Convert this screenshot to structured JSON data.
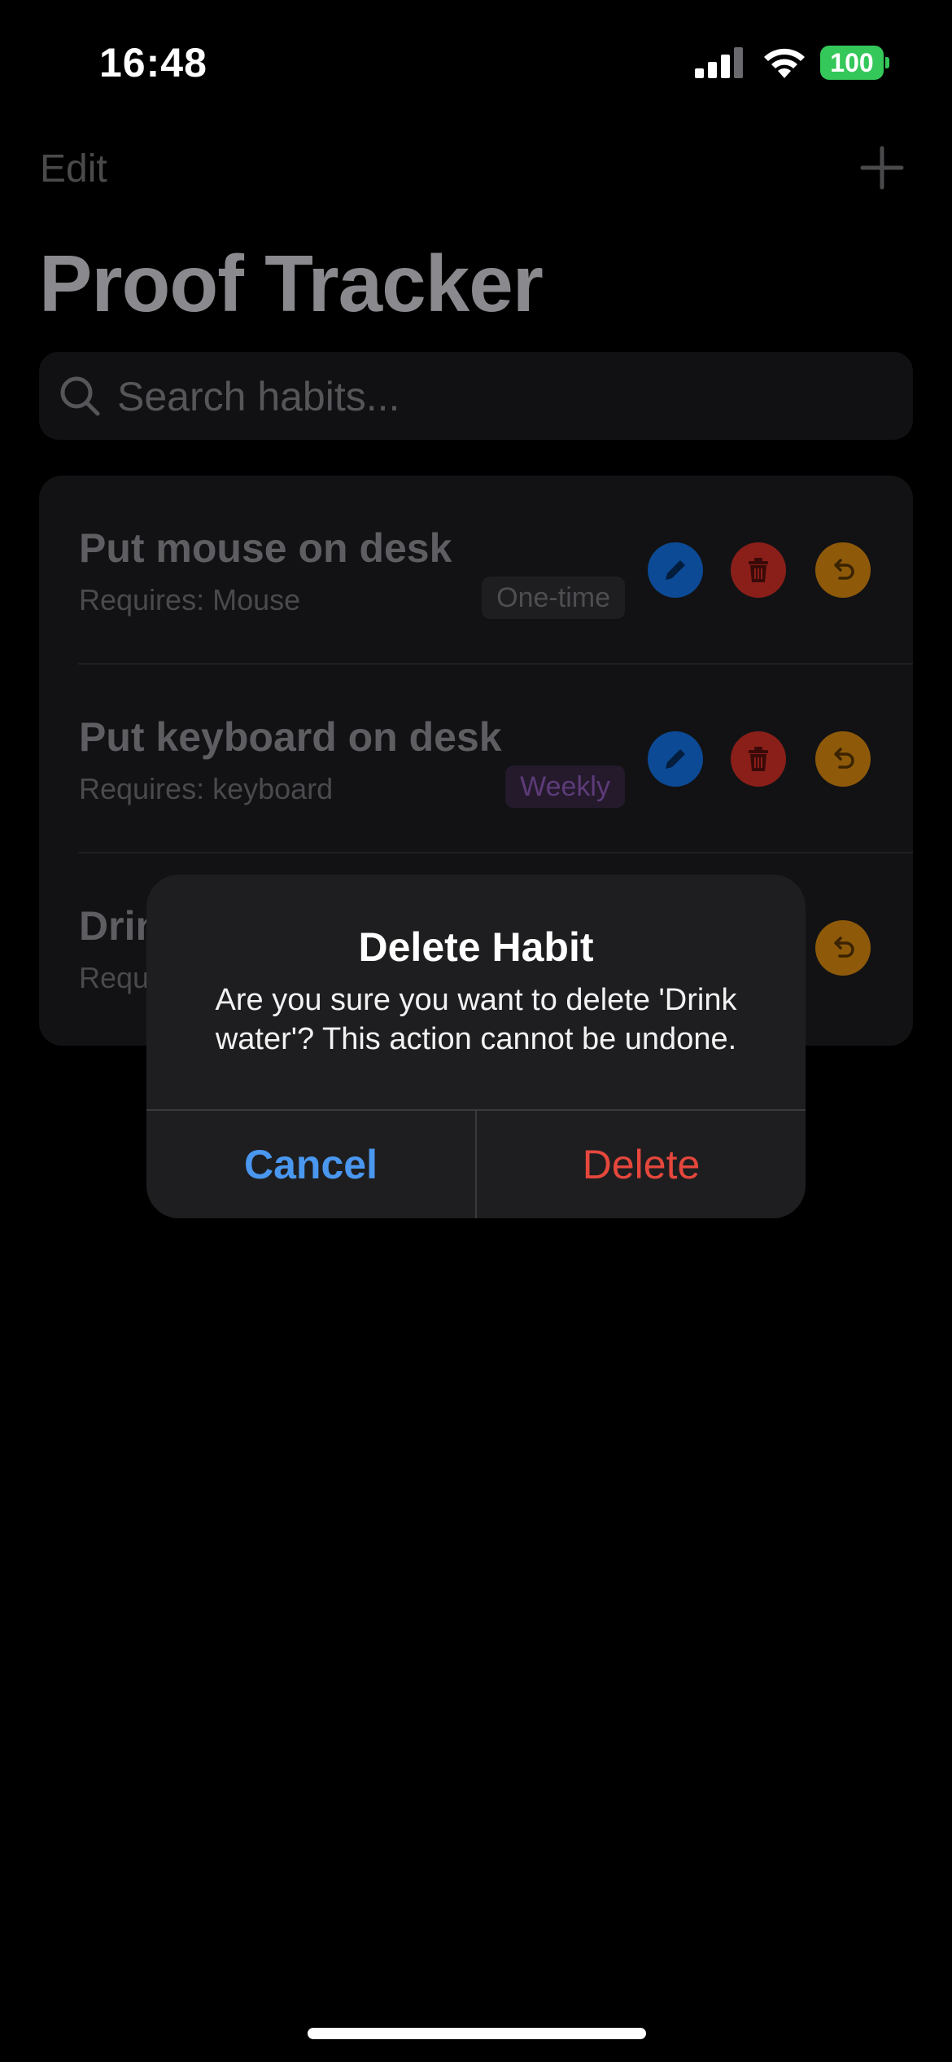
{
  "status_bar": {
    "time": "16:48",
    "battery": "100",
    "signal_icon": "cellular-signal-icon",
    "wifi_icon": "wifi-icon",
    "battery_color": "#34c759"
  },
  "nav": {
    "edit_label": "Edit",
    "add_icon": "plus-icon"
  },
  "page": {
    "title": "Proof Tracker"
  },
  "search": {
    "placeholder": "Search habits..."
  },
  "habits": [
    {
      "name": "Put mouse on desk",
      "requires": "Requires: Mouse",
      "frequency": "One-time"
    },
    {
      "name": "Put keyboard on desk",
      "requires": "Requires: keyboard",
      "frequency": "Weekly"
    },
    {
      "name": "Drin",
      "requires": "Requ",
      "frequency": ""
    }
  ],
  "actions": {
    "edit_color": "#0a84ff",
    "delete_color": "#ff3b30",
    "undo_color": "#ff9f0a"
  },
  "alert": {
    "title": "Delete Habit",
    "message": "Are you sure you want to delete 'Drink water'? This action cannot be undone.",
    "cancel_label": "Cancel",
    "delete_label": "Delete"
  }
}
